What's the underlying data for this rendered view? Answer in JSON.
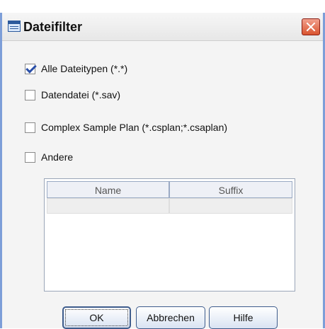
{
  "window": {
    "title": "Dateifilter",
    "title_icon": "dialog-table-icon",
    "close_icon": "close-icon"
  },
  "options": [
    {
      "label": "Alle Dateitypen (*.*)",
      "checked": true
    },
    {
      "label": "Datendatei (*.sav)",
      "checked": false
    },
    {
      "label": "Complex Sample Plan (*.csplan;*.csaplan)",
      "checked": false
    },
    {
      "label": "Andere",
      "checked": false
    }
  ],
  "table": {
    "headers": [
      "Name",
      "Suffix"
    ],
    "rows": [
      [
        "",
        ""
      ]
    ]
  },
  "buttons": {
    "ok": "OK",
    "cancel": "Abbrechen",
    "help": "Hilfe"
  },
  "colors": {
    "close_button": "#d9542f",
    "check_accent": "#2a4fa8",
    "button_border": "#3e5c8c"
  }
}
